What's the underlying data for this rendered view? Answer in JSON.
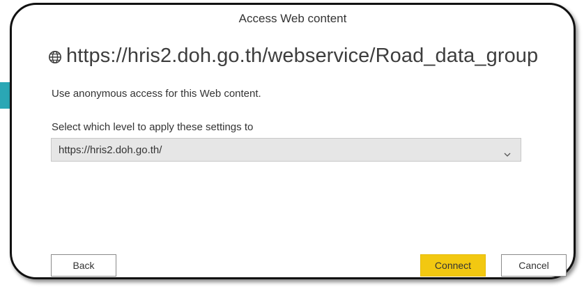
{
  "dialog": {
    "title": "Access Web content",
    "url": "https://hris2.doh.go.th/webservice/Road_data_group",
    "anonymous_text": "Use anonymous access for this Web content.",
    "level_label": "Select which level to apply these settings to",
    "level_select": {
      "value": "https://hris2.doh.go.th/"
    },
    "buttons": {
      "back": "Back",
      "connect": "Connect",
      "cancel": "Cancel"
    }
  },
  "icons": {
    "url": "globe-icon",
    "select": "chevron-down-icon"
  },
  "colors": {
    "connect_button": "#f2c811",
    "select_background": "#e6e6e6",
    "left_accent": "#2aa7b5"
  }
}
